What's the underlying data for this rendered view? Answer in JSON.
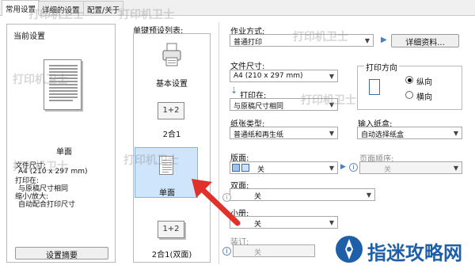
{
  "tabs": [
    "常用设置",
    "详细的设置",
    "配置/关于"
  ],
  "current": {
    "title": "当前设置",
    "preview_caption": "单面",
    "size_label": "文件尺寸:",
    "size_value": "A4 (210 x 297 mm)",
    "print_on_label": "打印在:",
    "print_on_value": "与原稿尺寸相同",
    "scale_label": "缩小/放大:",
    "scale_value": "自动配合打印尺寸",
    "summary_button": "设置摘要"
  },
  "presets": {
    "title": "单键预设列表:",
    "items": [
      {
        "label": "基本设置",
        "icon": "printer-icon"
      },
      {
        "label": "2合1",
        "icon": "2in1-icon",
        "glyph": "1+2"
      },
      {
        "label": "单面",
        "icon": "single-page-icon"
      },
      {
        "label": "2合1(双面)",
        "icon": "2in1-duplex-icon",
        "glyph": "1+2"
      }
    ],
    "selected_index": 2
  },
  "job": {
    "label": "作业方式:",
    "value": "普通打印",
    "detail_button": "详细资料..."
  },
  "doc_size": {
    "label": "文件尺寸:",
    "value": "A4 (210 x 297 mm)"
  },
  "print_on": {
    "label": "打印在:",
    "value": "与原稿尺寸相同"
  },
  "orientation": {
    "title": "打印方向",
    "options": [
      "纵向",
      "横向"
    ],
    "selected": "纵向"
  },
  "paper_type": {
    "label": "纸张类型:",
    "value": "普通纸和再生纸"
  },
  "input_tray": {
    "label": "输入纸盒:",
    "value": "自动选择纸盒"
  },
  "layout": {
    "label": "版面:",
    "value": "关"
  },
  "page_order": {
    "label": "页面顺序:",
    "value": "关"
  },
  "duplex": {
    "label": "双面:",
    "value": "关"
  },
  "booklet": {
    "label": "小册:",
    "value": "关"
  },
  "staple": {
    "label": "装订:",
    "value": "关"
  },
  "watermarks": [
    "打印机卫士",
    "打印机卫士",
    "打印机卫士",
    "打印机卫士",
    "打印机卫士",
    "打印机卫士",
    "打印机卫士"
  ],
  "brand": {
    "text": "指迷攻略网",
    "color": "#1f5fa8"
  },
  "colors": {
    "selection": "#cfe5fb",
    "arrow": "#e0322b"
  }
}
